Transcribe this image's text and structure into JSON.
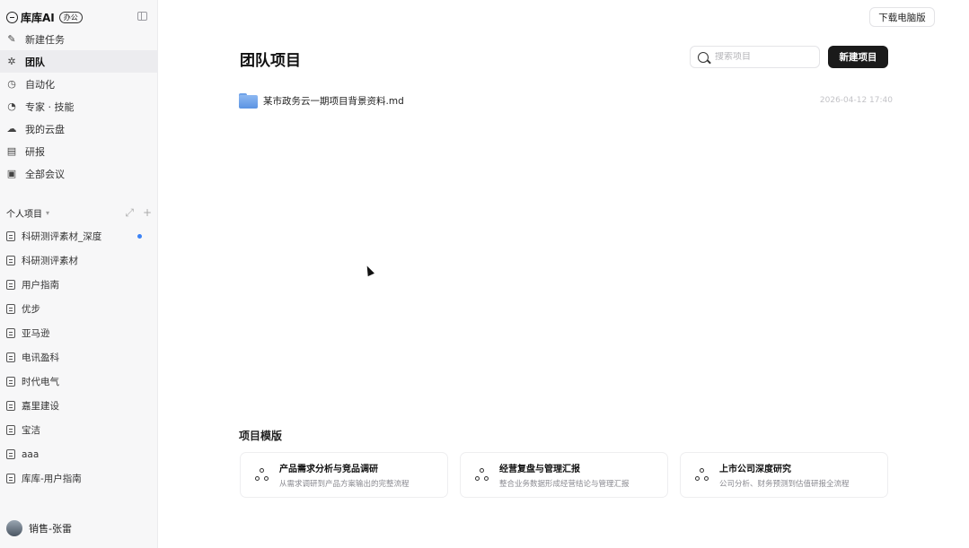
{
  "brand": {
    "name": "库库AI",
    "badge": "办公"
  },
  "nav": [
    {
      "label": "新建任务",
      "icon": "edit-icon",
      "active": false
    },
    {
      "label": "团队",
      "icon": "team-icon",
      "active": true
    },
    {
      "label": "自动化",
      "icon": "clock-icon",
      "active": false
    },
    {
      "label": "专家 · 技能",
      "icon": "expert-icon",
      "active": false
    },
    {
      "label": "我的云盘",
      "icon": "cloud-icon",
      "active": false
    },
    {
      "label": "研报",
      "icon": "report-icon",
      "active": false
    },
    {
      "label": "全部会议",
      "icon": "meeting-icon",
      "active": false
    }
  ],
  "projects_section": {
    "title": "个人项目"
  },
  "projects": [
    {
      "label": "科研测评素材_深度",
      "unread": true
    },
    {
      "label": "科研测评素材",
      "unread": false
    },
    {
      "label": "用户指南",
      "unread": false
    },
    {
      "label": "优步",
      "unread": false
    },
    {
      "label": "亚马逊",
      "unread": false
    },
    {
      "label": "电讯盈科",
      "unread": false
    },
    {
      "label": "时代电气",
      "unread": false
    },
    {
      "label": "嘉里建设",
      "unread": false
    },
    {
      "label": "宝洁",
      "unread": false
    },
    {
      "label": "aaa",
      "unread": false
    },
    {
      "label": "库库-用户指南",
      "unread": false
    }
  ],
  "user": {
    "name": "销售-张雷"
  },
  "header": {
    "download_label": "下载电脑版"
  },
  "main": {
    "title": "团队项目",
    "search_placeholder": "搜索项目",
    "new_project_label": "新建项目",
    "files": [
      {
        "name": "某市政务云一期项目背景资料.md",
        "time": "2026-04-12 17:40"
      }
    ]
  },
  "templates": {
    "title": "项目模版",
    "items": [
      {
        "name": "产品需求分析与竞品调研",
        "desc": "从需求调研到产品方案输出的完整流程"
      },
      {
        "name": "经营复盘与管理汇报",
        "desc": "整合业务数据形成经营结论与管理汇报"
      },
      {
        "name": "上市公司深度研究",
        "desc": "公司分析、财务预测到估值研报全流程"
      }
    ]
  },
  "colors": {
    "accent_dark": "#1a1a1a",
    "unread_dot": "#3b82f6",
    "folder": "#6fa2e8"
  }
}
